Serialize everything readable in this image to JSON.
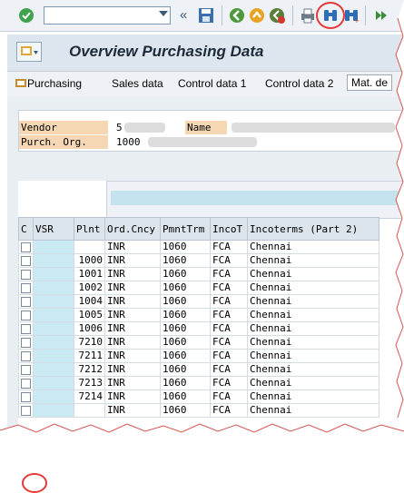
{
  "toolbar": {
    "icons": [
      "check-icon",
      "back-double-icon",
      "save-icon",
      "back-icon",
      "exit-icon",
      "cancel-icon",
      "print-icon",
      "find-icon",
      "find-next-icon",
      "first-page-icon"
    ],
    "command_placeholder": ""
  },
  "title": "Overview Purchasing Data",
  "tabs": [
    "Purchasing",
    "Sales data",
    "Control data 1",
    "Control data 2",
    "Mat. de"
  ],
  "header": {
    "vendor_label": "Vendor",
    "vendor_value": "5",
    "name_label": "Name",
    "purch_org_label": "Purch. Org.",
    "purch_org_value": "1000"
  },
  "grid": {
    "columns": [
      "C",
      "VSR",
      "Plnt",
      "Ord.Cncy",
      "PmntTrm",
      "IncoT",
      "Incoterms (Part 2)"
    ],
    "rows": [
      {
        "plnt": "",
        "cncy": "INR",
        "pmnt": "1060",
        "inco": "FCA",
        "inco2": "Chennai"
      },
      {
        "plnt": "1000",
        "cncy": "INR",
        "pmnt": "1060",
        "inco": "FCA",
        "inco2": "Chennai"
      },
      {
        "plnt": "1001",
        "cncy": "INR",
        "pmnt": "1060",
        "inco": "FCA",
        "inco2": "Chennai"
      },
      {
        "plnt": "1002",
        "cncy": "INR",
        "pmnt": "1060",
        "inco": "FCA",
        "inco2": "Chennai"
      },
      {
        "plnt": "1004",
        "cncy": "INR",
        "pmnt": "1060",
        "inco": "FCA",
        "inco2": "Chennai"
      },
      {
        "plnt": "1005",
        "cncy": "INR",
        "pmnt": "1060",
        "inco": "FCA",
        "inco2": "Chennai"
      },
      {
        "plnt": "1006",
        "cncy": "INR",
        "pmnt": "1060",
        "inco": "FCA",
        "inco2": "Chennai"
      },
      {
        "plnt": "7210",
        "cncy": "INR",
        "pmnt": "1060",
        "inco": "FCA",
        "inco2": "Chennai"
      },
      {
        "plnt": "7211",
        "cncy": "INR",
        "pmnt": "1060",
        "inco": "FCA",
        "inco2": "Chennai"
      },
      {
        "plnt": "7212",
        "cncy": "INR",
        "pmnt": "1060",
        "inco": "FCA",
        "inco2": "Chennai"
      },
      {
        "plnt": "7213",
        "cncy": "INR",
        "pmnt": "1060",
        "inco": "FCA",
        "inco2": "Chennai"
      },
      {
        "plnt": "7214",
        "cncy": "INR",
        "pmnt": "1060",
        "inco": "FCA",
        "inco2": "Chennai"
      },
      {
        "plnt": "",
        "cncy": "INR",
        "pmnt": "1060",
        "inco": "FCA",
        "inco2": "Chennai"
      }
    ]
  },
  "colors": {
    "accent": "#e53935",
    "header_label_bg": "#f6d7b4",
    "vsr_bg": "#c9e9f3"
  }
}
